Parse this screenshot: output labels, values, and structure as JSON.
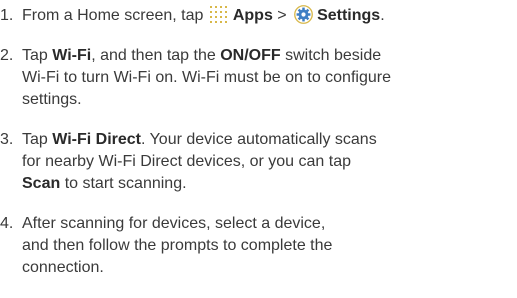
{
  "steps": [
    {
      "number": "1.",
      "lines": [
        {
          "a": "From a Home screen, tap ",
          "apps_label": "Apps",
          "sep": " > ",
          "settings_label": "Settings",
          "end": "."
        }
      ]
    },
    {
      "number": "2.",
      "lines": [
        {
          "a": "Tap ",
          "b1": "Wi-Fi",
          "c": ", and then tap the ",
          "b2": "ON/OFF",
          "d": " switch beside"
        },
        {
          "t": "Wi-Fi to turn Wi-Fi on. Wi-Fi must be on to configure"
        },
        {
          "t": "settings."
        }
      ]
    },
    {
      "number": "3.",
      "lines": [
        {
          "a": "Tap ",
          "b1": "Wi-Fi Direct",
          "c": ". Your device automatically scans"
        },
        {
          "t": "for nearby Wi-Fi Direct devices, or you can tap"
        },
        {
          "b1": "Scan",
          "c": " to start scanning."
        }
      ]
    },
    {
      "number": "4.",
      "lines": [
        {
          "t": "After scanning for devices, select a device,"
        },
        {
          "t": "and then follow the prompts to complete the"
        },
        {
          "t": "connection."
        }
      ]
    }
  ],
  "icons": {
    "apps": "apps-grid-icon",
    "settings": "settings-gear-icon"
  },
  "colors": {
    "text": "#3a3a3a",
    "icon_dots": "#d8b84a",
    "gear_blue": "#3f7fc4"
  }
}
